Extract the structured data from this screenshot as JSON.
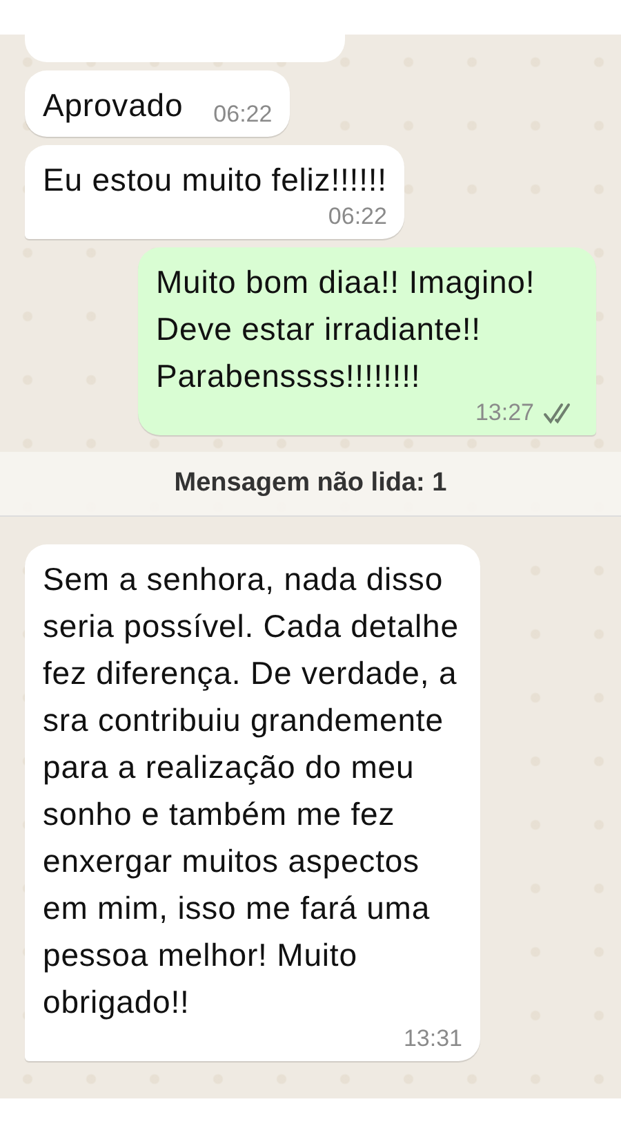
{
  "messages": [
    {
      "kind": "partial"
    },
    {
      "kind": "received",
      "text": "Aprovado",
      "time": "06:22",
      "tail": false,
      "inline_time": true
    },
    {
      "kind": "received",
      "text": "Eu estou muito feliz!!!!!!",
      "time": "06:22",
      "tail": true
    },
    {
      "kind": "sent",
      "text": "Muito bom diaa!! Imagino! Deve estar irradiante!! Parabenssss!!!!!!!!",
      "time": "13:27",
      "tail": true,
      "read": true
    },
    {
      "kind": "divider",
      "text": "Mensagem não lida: 1"
    },
    {
      "kind": "received",
      "text": "Sem a senhora, nada disso seria possível. Cada detalhe fez diferença. De verdade, a sra contribuiu grandemente para a realização do meu sonho e também me fez enxergar muitos aspectos em mim, isso me fará uma pessoa melhor! Muito obrigado!!",
      "time": "13:31",
      "tail": true
    }
  ]
}
